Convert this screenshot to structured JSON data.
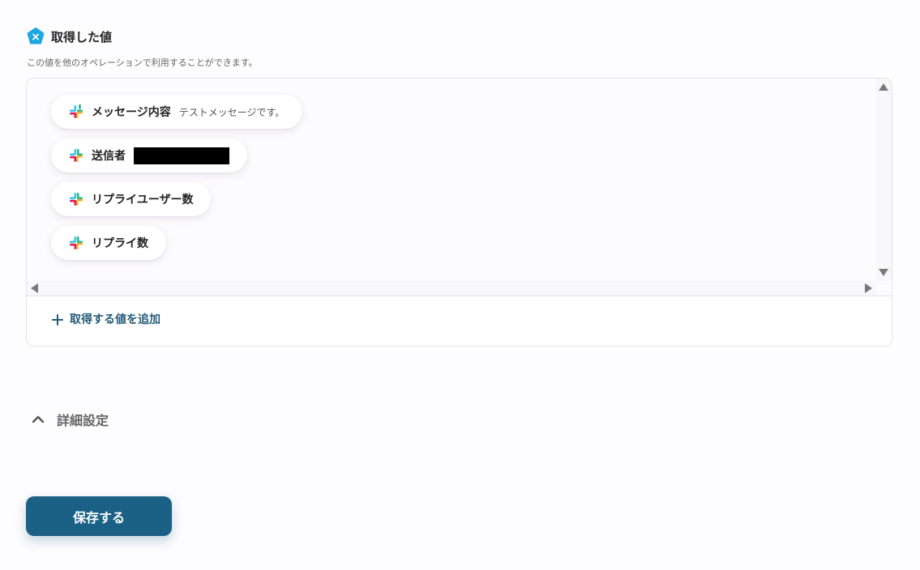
{
  "section": {
    "title": "取得した値",
    "description": "この値を他のオペレーションで利用することができます。",
    "icon": "x-variable-badge-icon",
    "icon_color": "#1ea7e1"
  },
  "values": [
    {
      "label": "メッセージ内容",
      "value": "テストメッセージです。",
      "icon": "slack-icon"
    },
    {
      "label": "送信者",
      "value": "",
      "redacted": true,
      "icon": "slack-icon"
    },
    {
      "label": "リプライユーザー数",
      "value": "",
      "icon": "slack-icon"
    },
    {
      "label": "リプライ数",
      "value": "",
      "icon": "slack-icon"
    }
  ],
  "add_value_label": "取得する値を追加",
  "advanced_settings_label": "詳細設定",
  "save_label": "保存する",
  "colors": {
    "accent": "#1b6085",
    "link": "#245b78"
  }
}
